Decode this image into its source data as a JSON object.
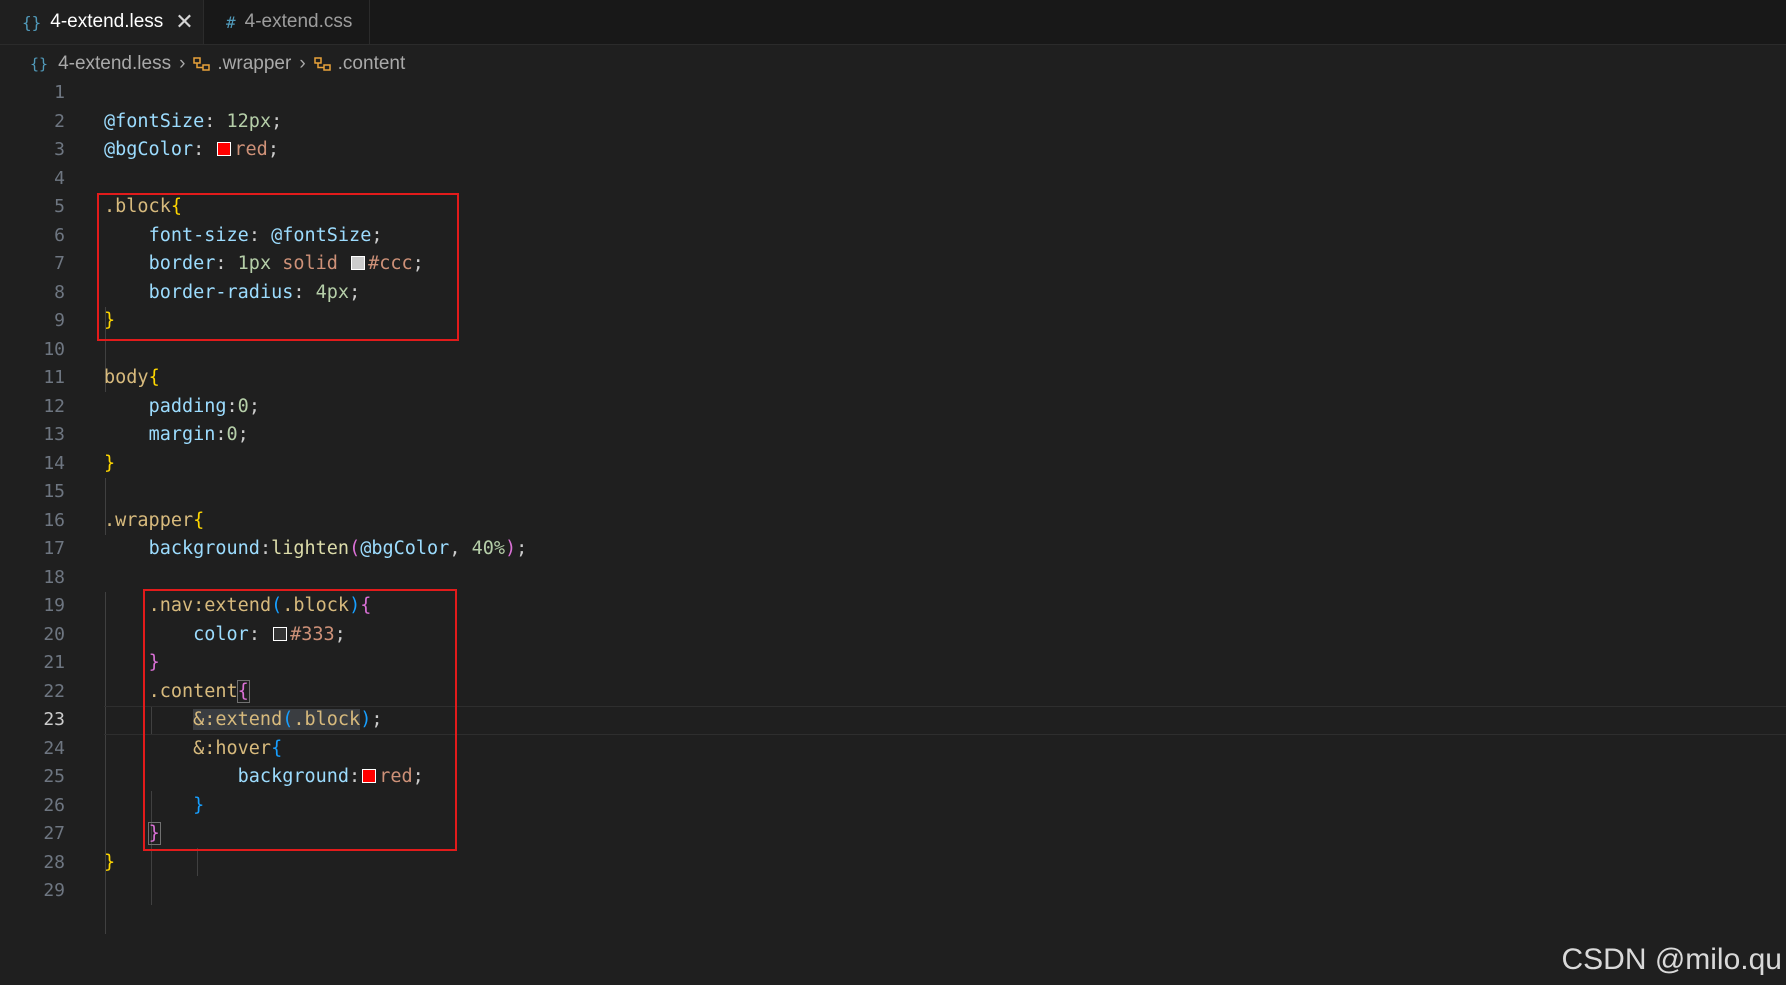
{
  "tabs": [
    {
      "label": "4-extend.less",
      "icon": "{}",
      "active": true
    },
    {
      "label": "4-extend.css",
      "icon": "#",
      "active": false
    }
  ],
  "breadcrumb": {
    "file": "4-extend.less",
    "symbols": [
      ".wrapper",
      ".content"
    ]
  },
  "current_line": 23,
  "code": {
    "fontsize_var": "@fontSize",
    "fontsize_val": "12px",
    "bgcolor_var": "@bgColor",
    "red_val": "red",
    "block_sel": ".block",
    "font_size_prop": "font-size",
    "border_prop": "border",
    "border_width": "1px",
    "border_style": "solid",
    "ccc_val": "#ccc",
    "border_radius_prop": "border-radius",
    "radius_val": "4px",
    "body_sel": "body",
    "padding_prop": "padding",
    "zero": "0",
    "margin_prop": "margin",
    "wrapper_sel": ".wrapper",
    "background_prop": "background",
    "lighten_fn": "lighten",
    "percent_val": "40%",
    "nav_sel": ".nav:extend",
    "color_prop": "color",
    "color333_val": "#333",
    "content_sel": ".content",
    "amp_extend": "&:extend",
    "amp_hover": "&:hover"
  },
  "swatch_colors": {
    "red": "#ff0000",
    "ccc": "#cccccc",
    "c333": "#333333"
  },
  "watermark": "CSDN @milo.qu",
  "colors": {
    "annotation_box": "#e21b1b",
    "editor_bg": "#1f1f1f"
  }
}
